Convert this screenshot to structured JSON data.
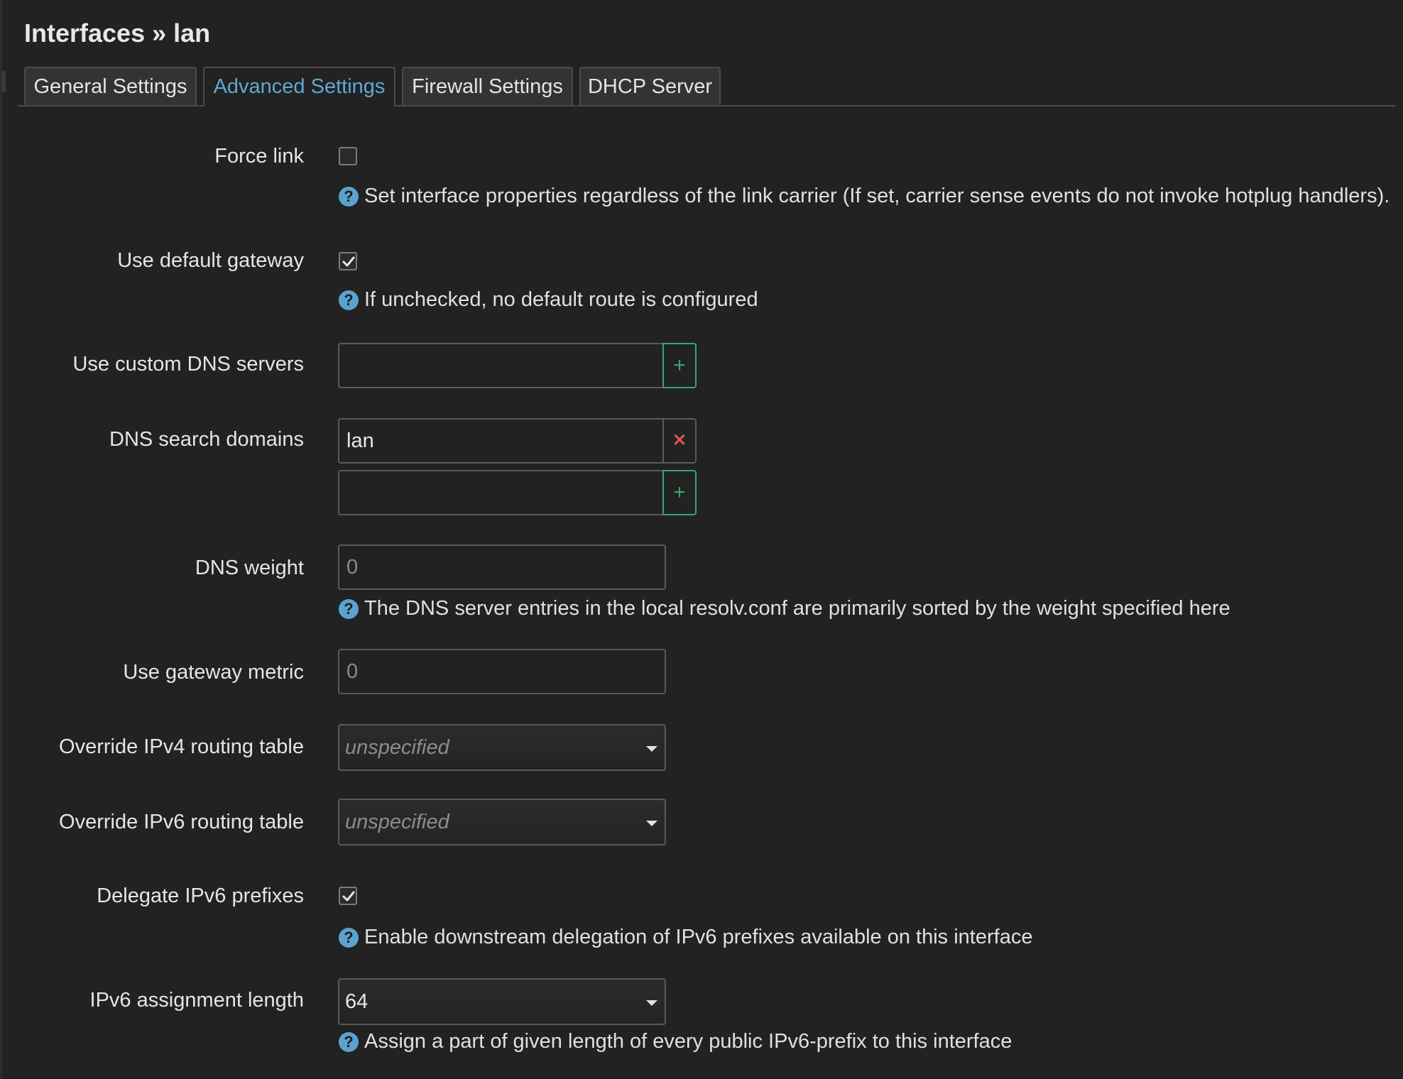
{
  "page": {
    "title": "Interfaces » lan"
  },
  "tabs": [
    {
      "label": "General Settings",
      "active": false
    },
    {
      "label": "Advanced Settings",
      "active": true
    },
    {
      "label": "Firewall Settings",
      "active": false
    },
    {
      "label": "DHCP Server",
      "active": false
    }
  ],
  "colors": {
    "background": "#222222",
    "active_tab": "#5fa8d3",
    "help_icon": "#5aa3cf",
    "add_button": "#3aa569",
    "remove_button": "#d9534f"
  },
  "fields": {
    "force_link": {
      "label": "Force link",
      "checked": false,
      "help": "Set interface properties regardless of the link carrier (If set, carrier sense events do not invoke hotplug handlers)."
    },
    "default_gateway": {
      "label": "Use default gateway",
      "checked": true,
      "help": "If unchecked, no default route is configured"
    },
    "custom_dns": {
      "label": "Use custom DNS servers",
      "value": ""
    },
    "dns_search": {
      "label": "DNS search domains",
      "entries": [
        "lan"
      ],
      "new_value": ""
    },
    "dns_weight": {
      "label": "DNS weight",
      "placeholder": "0",
      "help": "The DNS server entries in the local resolv.conf are primarily sorted by the weight specified here"
    },
    "gateway_metric": {
      "label": "Use gateway metric",
      "placeholder": "0"
    },
    "ipv4_table": {
      "label": "Override IPv4 routing table",
      "value": "unspecified"
    },
    "ipv6_table": {
      "label": "Override IPv6 routing table",
      "value": "unspecified"
    },
    "delegate_ipv6": {
      "label": "Delegate IPv6 prefixes",
      "checked": true,
      "help": "Enable downstream delegation of IPv6 prefixes available on this interface"
    },
    "ipv6_assign": {
      "label": "IPv6 assignment length",
      "value": "64",
      "help": "Assign a part of given length of every public IPv6-prefix to this interface"
    }
  },
  "icons": {
    "help": "help-circle-icon",
    "check": "checkmark-icon",
    "add": "plus-icon",
    "remove": "x-icon",
    "dropdown": "caret-down-icon"
  }
}
